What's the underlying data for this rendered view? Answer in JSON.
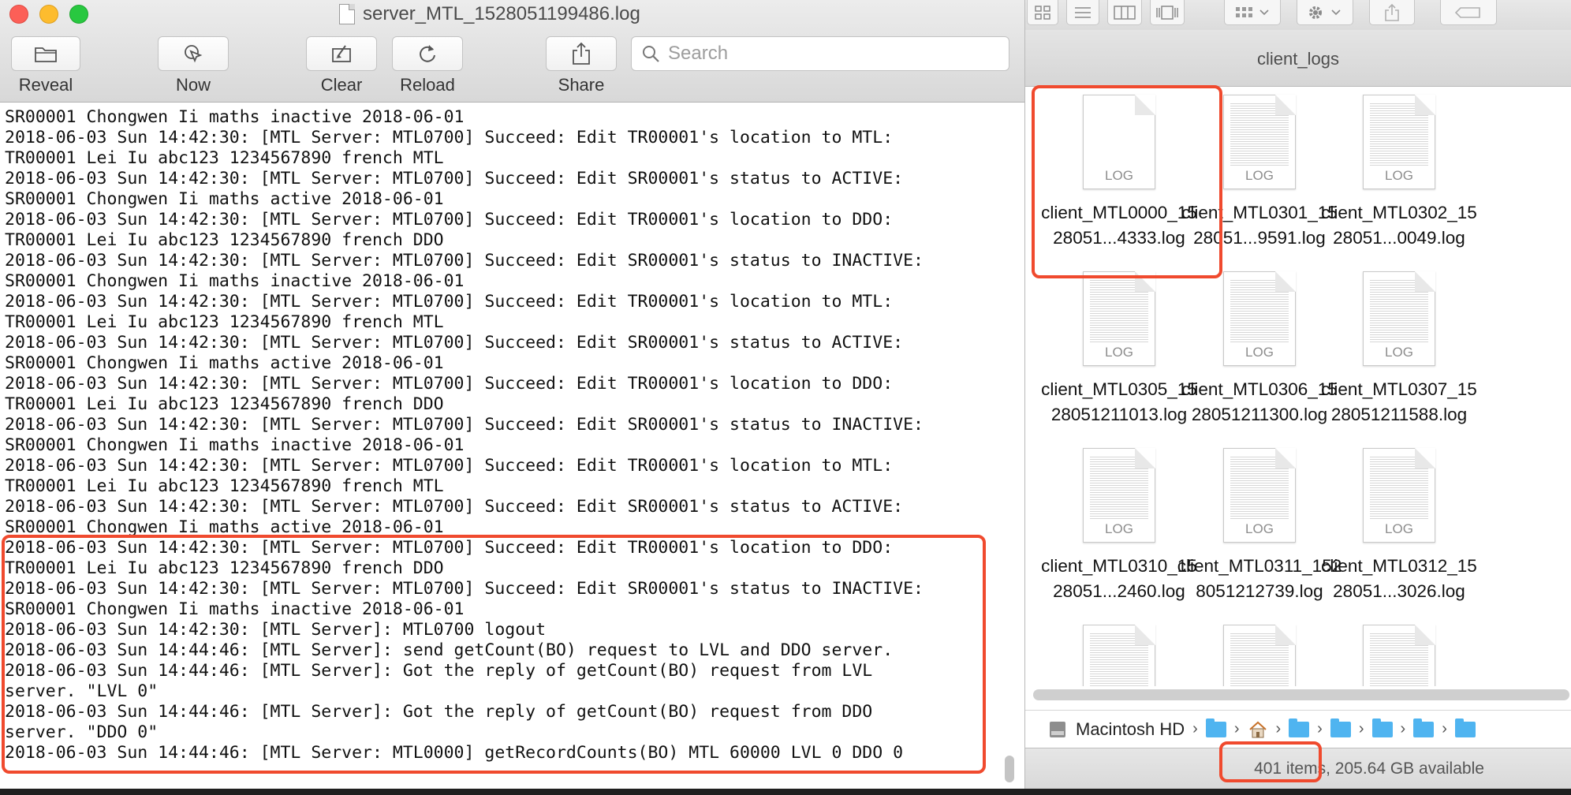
{
  "console": {
    "title": "server_MTL_1528051199486.log",
    "toolbar": [
      {
        "label": "Reveal",
        "icon": "folder-icon"
      },
      {
        "label": "Now",
        "icon": "cursor-arrow-icon"
      },
      {
        "label": "Clear",
        "icon": "broom-icon"
      },
      {
        "label": "Reload",
        "icon": "reload-icon"
      },
      {
        "label": "Share",
        "icon": "share-icon"
      }
    ],
    "search_placeholder": "Search",
    "log_lines": [
      "SR00001 Chongwen Ii maths inactive 2018-06-01",
      "2018-06-03 Sun 14:42:30: [MTL Server: MTL0700] Succeed: Edit TR00001's location to MTL:",
      "TR00001 Lei Iu abc123 1234567890 french MTL",
      "2018-06-03 Sun 14:42:30: [MTL Server: MTL0700] Succeed: Edit SR00001's status to ACTIVE:",
      "SR00001 Chongwen Ii maths active 2018-06-01",
      "2018-06-03 Sun 14:42:30: [MTL Server: MTL0700] Succeed: Edit TR00001's location to DDO:",
      "TR00001 Lei Iu abc123 1234567890 french DDO",
      "2018-06-03 Sun 14:42:30: [MTL Server: MTL0700] Succeed: Edit SR00001's status to INACTIVE:",
      "SR00001 Chongwen Ii maths inactive 2018-06-01",
      "2018-06-03 Sun 14:42:30: [MTL Server: MTL0700] Succeed: Edit TR00001's location to MTL:",
      "TR00001 Lei Iu abc123 1234567890 french MTL",
      "2018-06-03 Sun 14:42:30: [MTL Server: MTL0700] Succeed: Edit SR00001's status to ACTIVE:",
      "SR00001 Chongwen Ii maths active 2018-06-01",
      "2018-06-03 Sun 14:42:30: [MTL Server: MTL0700] Succeed: Edit TR00001's location to DDO:",
      "TR00001 Lei Iu abc123 1234567890 french DDO",
      "2018-06-03 Sun 14:42:30: [MTL Server: MTL0700] Succeed: Edit SR00001's status to INACTIVE:",
      "SR00001 Chongwen Ii maths inactive 2018-06-01",
      "2018-06-03 Sun 14:42:30: [MTL Server: MTL0700] Succeed: Edit TR00001's location to MTL:",
      "TR00001 Lei Iu abc123 1234567890 french MTL",
      "2018-06-03 Sun 14:42:30: [MTL Server: MTL0700] Succeed: Edit SR00001's status to ACTIVE:",
      "SR00001 Chongwen Ii maths active 2018-06-01",
      "2018-06-03 Sun 14:42:30: [MTL Server: MTL0700] Succeed: Edit TR00001's location to DDO:",
      "TR00001 Lei Iu abc123 1234567890 french DDO",
      "2018-06-03 Sun 14:42:30: [MTL Server: MTL0700] Succeed: Edit SR00001's status to INACTIVE:",
      "SR00001 Chongwen Ii maths inactive 2018-06-01",
      "2018-06-03 Sun 14:42:30: [MTL Server]: MTL0700 logout",
      "2018-06-03 Sun 14:44:46: [MTL Server]: send getCount(BO) request to LVL and DDO server.",
      "2018-06-03 Sun 14:44:46: [MTL Server]: Got the reply of getCount(BO) request from LVL",
      "server. \"LVL 0\"",
      "2018-06-03 Sun 14:44:46: [MTL Server]: Got the reply of getCount(BO) request from DDO",
      "server. \"DDO 0\"",
      "2018-06-03 Sun 14:44:46: [MTL Server: MTL0000] getRecordCounts(BO) MTL 60000 LVL 0 DDO 0"
    ],
    "highlight_color": "#f04a2e"
  },
  "finder": {
    "folder_title": "client_logs",
    "files": [
      {
        "name": "client_MTL0000_1528051...4333.log",
        "icon_label": "LOG"
      },
      {
        "name": "client_MTL0301_1528051...9591.log",
        "icon_label": "LOG"
      },
      {
        "name": "client_MTL0302_1528051...0049.log",
        "icon_label": "LOG"
      },
      {
        "name": "client_MTL0305_1528051211013.log",
        "icon_label": "LOG"
      },
      {
        "name": "client_MTL0306_1528051211300.log",
        "icon_label": "LOG"
      },
      {
        "name": "client_MTL0307_1528051211588.log",
        "icon_label": "LOG"
      },
      {
        "name": "client_MTL0310_1528051...2460.log",
        "icon_label": "LOG"
      },
      {
        "name": "client_MTL0311_1528051212739.log",
        "icon_label": "LOG"
      },
      {
        "name": "client_MTL0312_1528051...3026.log",
        "icon_label": "LOG"
      }
    ],
    "path": {
      "volume": "Macintosh HD"
    },
    "status": "401 items, 205.64 GB available"
  }
}
